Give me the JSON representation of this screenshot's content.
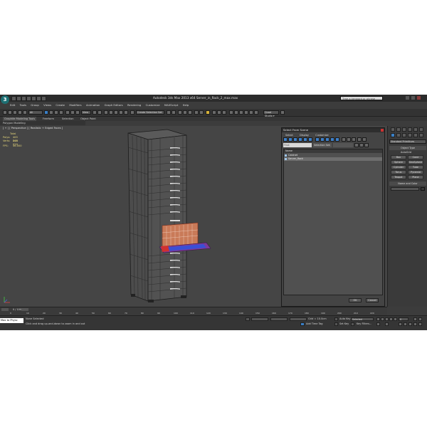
{
  "app": {
    "logo_letter": "3",
    "title": "Autodesk 3ds Max 2013 x64    Server_in_Rack_2_max.max",
    "search_placeholder": "Type a keyword or phrase"
  },
  "menu": [
    "Edit",
    "Tools",
    "Group",
    "Views",
    "Create",
    "Modifiers",
    "Animation",
    "Graph Editors",
    "Rendering",
    "Customize",
    "MAXScript",
    "Help"
  ],
  "toolbar": {
    "filter_value": "All",
    "view_value": "View",
    "selection_set": "Create Selection Set",
    "studio_label": "Quad Studio ▾"
  },
  "ribbon": {
    "tabs": [
      "Graphite Modeling Tools",
      "Freeform",
      "Selection",
      "Object Paint"
    ],
    "sub": "Polygon Modeling"
  },
  "viewport": {
    "label": "[ + ] [ Perspective ] [ Realistic + Edged Faces ]",
    "stats": [
      {
        "label": "Polys:",
        "value": "465 065"
      },
      {
        "label": "Verts:",
        "value": "248 020"
      },
      {
        "label": "FPS:",
        "value": "46.000"
      }
    ],
    "stats_title": "Total"
  },
  "dialog": {
    "title": "Select From Scene",
    "menu": [
      "Select",
      "Display",
      "Customize"
    ],
    "find_placeholder": "Find:",
    "selection_set": "Selection Set:",
    "column_header": "Name",
    "rows": [
      "Cabinet",
      "Server_Rack"
    ],
    "ok": "OK",
    "cancel": "Cancel"
  },
  "command_panel": {
    "dropdown": "Standard Primitives",
    "object_type_header": "Object Type",
    "autogrid": "AutoGrid",
    "buttons": [
      "Box",
      "Cone",
      "Sphere",
      "GeoSphere",
      "Cylinder",
      "Tube",
      "Torus",
      "Pyramid",
      "Teapot",
      "Plane"
    ],
    "name_color_header": "Name and Color"
  },
  "timeline": {
    "frame": "0 / 100",
    "ticks": [
      "0",
      "10",
      "20",
      "30",
      "40",
      "50",
      "60",
      "70",
      "80",
      "90",
      "100",
      "110",
      "120",
      "130",
      "140",
      "150",
      "160",
      "170",
      "180",
      "190",
      "200",
      "210",
      "220"
    ]
  },
  "status": {
    "maxscript": "Max to Physc",
    "line1": "None Selected",
    "line2": "Click and drag up-and-down to zoom in and out",
    "grid": "Grid = 10.0cm",
    "auto_key": "Auto Key",
    "selected": "Selected",
    "set_key": "Set Key",
    "key_filters": "Key Filters...",
    "add_time_tag": "Add Time Tag",
    "frame_field": "0"
  },
  "colors": {
    "app_bg": "#3c3c3c",
    "viewport_bg": "#454545",
    "accent_blue": "#3a7fc6",
    "stats_yellow": "#e7d77a"
  }
}
